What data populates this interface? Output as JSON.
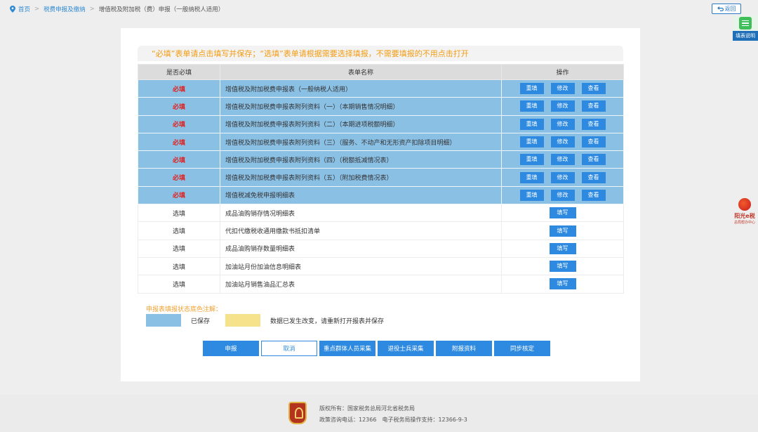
{
  "breadcrumb": {
    "home": "首页",
    "section": "税费申报及缴纳",
    "current": "增值税及附加税（费）申报（一般纳税人适用）"
  },
  "back_label": "返回",
  "help_label": "填表说明",
  "brand": {
    "name": "阳光e税",
    "sub": "总局帮办中心"
  },
  "notice": "“必填”表单请点击填写并保存；“选填”表单请根据需要选择填报，不需要填报的不用点击打开",
  "table": {
    "headers": [
      "是否必填",
      "表单名称",
      "操作"
    ],
    "required_label": "必填",
    "optional_label": "选填",
    "btn_refill": "重填",
    "btn_edit": "修改",
    "btn_view": "查看",
    "btn_fill": "填写",
    "required_rows": [
      "增值税及附加税费申报表（一般纳税人适用）",
      "增值税及附加税费申报表附列资料（一）（本期销售情况明细）",
      "增值税及附加税费申报表附列资料（二）（本期进项税额明细）",
      "增值税及附加税费申报表附列资料（三）（服务、不动产和无形资产扣除项目明细）",
      "增值税及附加税费申报表附列资料（四）（税额抵减情况表）",
      "增值税及附加税费申报表附列资料（五）（附加税费情况表）",
      "增值税减免税申报明细表"
    ],
    "optional_rows": [
      "成品油购销存情况明细表",
      "代扣代缴税收通用缴款书抵扣清单",
      "成品油购销存数量明细表",
      "加油站月份加油信息明细表",
      "加油站月销售油品汇总表"
    ]
  },
  "legend": {
    "title": "申报表填报状态底色注解：",
    "saved": "已保存",
    "changed": "数据已发生改变，请重新打开报表并保存"
  },
  "buttons": {
    "submit": "申报",
    "cancel": "取消",
    "key_group": "重点群体人员采集",
    "veteran": "退役士兵采集",
    "attachments": "附报资料",
    "sync": "同步核定"
  },
  "footer": {
    "copyright": "版权所有：国家税务总局河北省税务局",
    "contact": "政策咨询电话：12366　电子税务局操作支持：12366-9-3"
  },
  "colors": {
    "saved_row": "#8bc0e5",
    "changed_row": "#f5e28a",
    "primary": "#2d8ae0",
    "notice": "#f39c12",
    "required_text": "#e0201c"
  }
}
